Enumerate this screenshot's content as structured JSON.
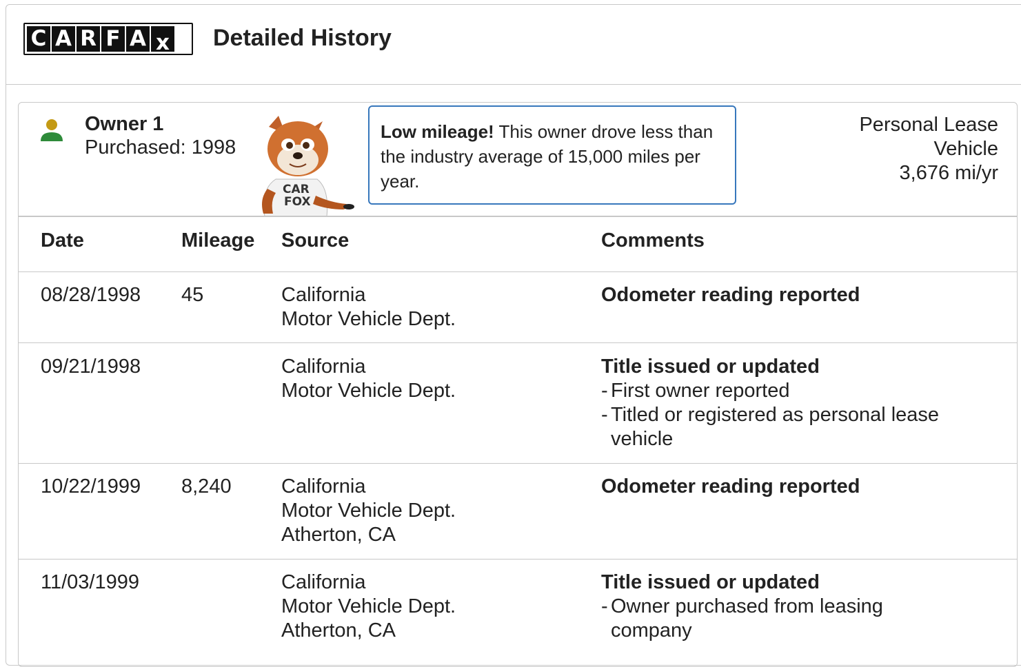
{
  "header": {
    "logo_letters": [
      "C",
      "A",
      "R",
      "F",
      "A",
      "x"
    ],
    "title": "Detailed History"
  },
  "owner": {
    "name": "Owner 1",
    "purchased": "Purchased: 1998",
    "icon": "person-icon",
    "mascot": "carfox-mascot",
    "mascot_shirt_text": "CAR FOX"
  },
  "callout": {
    "bold": "Low mileage!",
    "text": " This owner drove less than the industry average of 15,000 miles per year."
  },
  "usage": {
    "type_line1": "Personal Lease",
    "type_line2": "Vehicle",
    "mileage": "3,676 mi/yr"
  },
  "table": {
    "headers": [
      "Date",
      "Mileage",
      "Source",
      "Comments"
    ],
    "rows": [
      {
        "date": "08/28/1998",
        "mileage": "45",
        "source": [
          "California",
          "Motor Vehicle Dept."
        ],
        "comment_title": "Odometer reading reported",
        "comment_items": []
      },
      {
        "date": "09/21/1998",
        "mileage": "",
        "source": [
          "California",
          "Motor Vehicle Dept."
        ],
        "comment_title": "Title issued or updated",
        "comment_items": [
          "First owner reported",
          "Titled or registered as personal lease vehicle"
        ]
      },
      {
        "date": "10/22/1999",
        "mileage": "8,240",
        "source": [
          "California",
          "Motor Vehicle Dept.",
          "Atherton, CA"
        ],
        "comment_title": "Odometer reading reported",
        "comment_items": []
      },
      {
        "date": "11/03/1999",
        "mileage": "",
        "source": [
          "California",
          "Motor Vehicle Dept.",
          "Atherton, CA"
        ],
        "comment_title": "Title issued or updated",
        "comment_items": [
          "Owner purchased from leasing company"
        ]
      }
    ]
  },
  "colors": {
    "callout_border": "#3777bc",
    "person_head": "#c49a14",
    "person_body": "#2e8b3a",
    "divider": "#c8c8c8"
  }
}
